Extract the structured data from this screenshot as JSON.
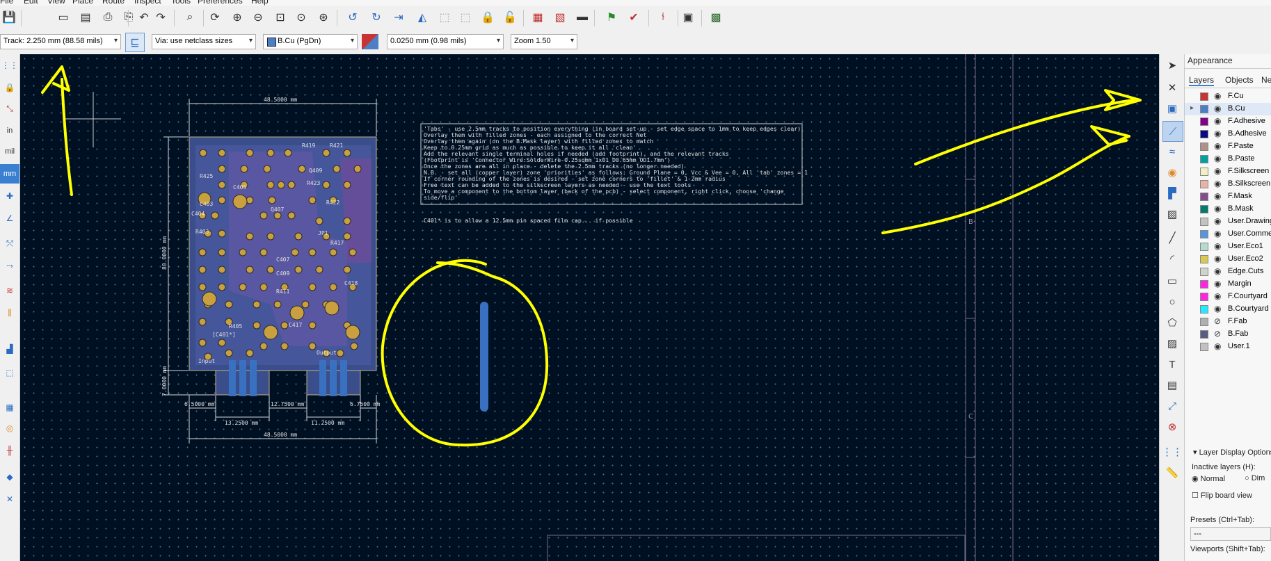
{
  "menu": {
    "items": [
      "File",
      "Edit",
      "View",
      "Place",
      "Route",
      "Inspect",
      "Tools",
      "Preferences",
      "Help"
    ]
  },
  "toolbar2": {
    "track": "Track: 2.250 mm (88.58 mils)",
    "via": "Via: use netclass sizes",
    "layer": "B.Cu (PgDn)",
    "grid": "0.0250 mm (0.98 mils)",
    "zoom": "Zoom 1.50"
  },
  "left_tools": {
    "in": "in",
    "mil": "mil",
    "mm": "mm"
  },
  "canvas": {
    "dims": {
      "top_width": "48.5000 mm",
      "height": "80.0000 mm",
      "tab_height": "7.0000 mm",
      "bottom_width": "48.5000 mm",
      "seg1": "6.5000 mm",
      "seg2": "13.2500 mm",
      "seg3": "12.7500 mm",
      "seg4": "11.2500 mm",
      "seg5": "6.7500 mm"
    },
    "notes": [
      "'Tabs' - use 2.5mm tracks to position everything (in board set-up - set edge space to 1mm to keep edges clear)",
      "Overlay them with filled zones - each assigned to the correct Net",
      "Overlay them again (on the B.Mask layer) with filled zones to match",
      "Keep to 0.25mm grid as much as possible to keep it all 'clean'",
      "Add the relevant single terminal holes if needed (add footprint), and the relevant tracks",
      "(Footprint is 'Connector_Wire:SolderWire-0.25sqmm_1x01_D0.65mm_OD1.7mm')",
      "Once the zones are all in place - delete the 2.5mm tracks (no longer needed)",
      "N.B. - set all (copper layer) zone 'priorities' as follows: Ground Plane = 0, Vcc & Vee = 0, All 'tab' zones = 1",
      "If corner rounding of the zones is desired - set zone corners to 'fillet' & 1-2mm radius",
      "Free text can be added to the silkscreen layers as needed - use the text tools",
      "To move a component to the bottom layer (back of the pcb) - select component, right click, choose 'change",
      "side/flip'"
    ],
    "note2": "C401* is to allow a 12.5mm pin spaced film cap... if possible",
    "sheet_marks": {
      "b": "B",
      "c": "C"
    },
    "pcb_labels": {
      "c403": "C403",
      "c404": "C404",
      "r419": "R419",
      "r421": "R421",
      "r425": "R425",
      "c405": "C405",
      "r422": "R422",
      "r423": "R423",
      "q407": "Q407",
      "jp1": "JP1",
      "r417": "R417",
      "c407": "C407",
      "c409": "C409",
      "r411": "R411",
      "r405": "R405",
      "c417": "C417",
      "c401": "[C401*]",
      "input": "Input",
      "output": "Output",
      "r403": "R403",
      "c418": "C418",
      "q409": "Q409"
    }
  },
  "appearance": {
    "title": "Appearance",
    "tabs": [
      "Layers",
      "Objects",
      "Ne"
    ],
    "layers": [
      {
        "name": "F.Cu",
        "color": "#c83434"
      },
      {
        "name": "B.Cu",
        "color": "#4d7fc4"
      },
      {
        "name": "F.Adhesive",
        "color": "#84008a"
      },
      {
        "name": "B.Adhesive",
        "color": "#0a0a82"
      },
      {
        "name": "F.Paste",
        "color": "#b0908a"
      },
      {
        "name": "B.Paste",
        "color": "#00a0a0"
      },
      {
        "name": "F.Silkscreen",
        "color": "#f0f0c0"
      },
      {
        "name": "B.Silkscreen",
        "color": "#e8b2a7"
      },
      {
        "name": "F.Mask",
        "color": "#844c8c"
      },
      {
        "name": "B.Mask",
        "color": "#027a6e"
      },
      {
        "name": "User.Drawings",
        "color": "#c2c2c2"
      },
      {
        "name": "User.Comments",
        "color": "#5994dc"
      },
      {
        "name": "User.Eco1",
        "color": "#b4dbd2"
      },
      {
        "name": "User.Eco2",
        "color": "#d8c852"
      },
      {
        "name": "Edge.Cuts",
        "color": "#d0d2cd"
      },
      {
        "name": "Margin",
        "color": "#ff26e2"
      },
      {
        "name": "F.Courtyard",
        "color": "#ff26e2"
      },
      {
        "name": "B.Courtyard",
        "color": "#26e9ff"
      },
      {
        "name": "F.Fab",
        "color": "#afafaf"
      },
      {
        "name": "B.Fab",
        "color": "#585d84"
      },
      {
        "name": "User.1",
        "color": "#c2c2c2"
      }
    ],
    "display_options": "Layer Display Options",
    "inactive_label": "Inactive layers (H):",
    "opt_normal": "Normal",
    "opt_dim": "Dim",
    "flip": "Flip board view",
    "presets": "Presets (Ctrl+Tab):",
    "presets_value": "---",
    "viewports": "Viewports (Shift+Tab):"
  },
  "colors": {
    "canvas_bg": "#001023",
    "annotation": "#ffff00",
    "board": "#3a4e8c",
    "pad": "#c8a040",
    "highlight": "#3a70c0"
  }
}
